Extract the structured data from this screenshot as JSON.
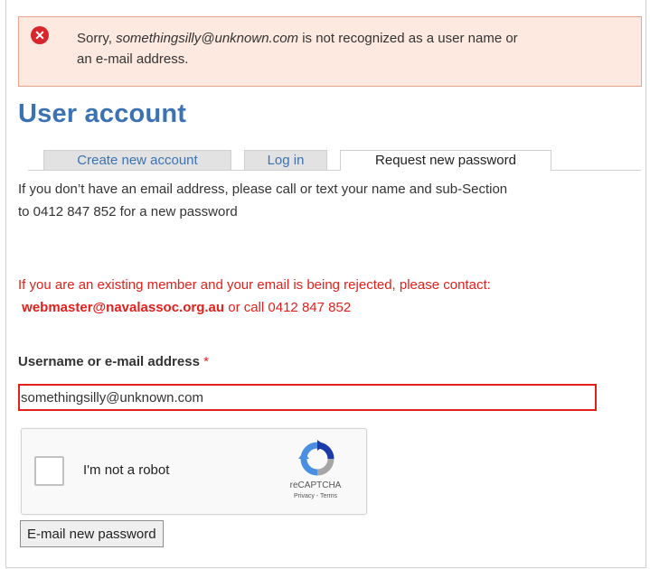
{
  "error": {
    "prefix": "Sorry, ",
    "email": "somethingsilly@unknown.com",
    "suffix_line1": " is not recognized as a user name or",
    "line2": "an e-mail address."
  },
  "page_title": "User account",
  "tabs": [
    {
      "label": "Create new account",
      "active": false
    },
    {
      "label": "Log in",
      "active": false
    },
    {
      "label": "Request new password",
      "active": true
    }
  ],
  "intro": {
    "line1": "If you don’t have an email address, please call or text your name and sub-Section",
    "line2": "to 0412 847 852 for a new password"
  },
  "warning": {
    "line1": "If you are an existing member and your email is being rejected, please contact:",
    "email": "webmaster@navalassoc.org.au",
    "line2_suffix": " or call 0412 847 852"
  },
  "form": {
    "label": "Username or e-mail address",
    "required_mark": "*",
    "value": "somethingsilly@unknown.com"
  },
  "captcha": {
    "label": "I'm not a robot",
    "brand": "reCAPTCHA",
    "links": "Privacy - Terms"
  },
  "submit_label": "E-mail new password",
  "colors": {
    "accent": "#3a72b3",
    "error": "#e3201b",
    "error_bg": "#fde9e0"
  }
}
